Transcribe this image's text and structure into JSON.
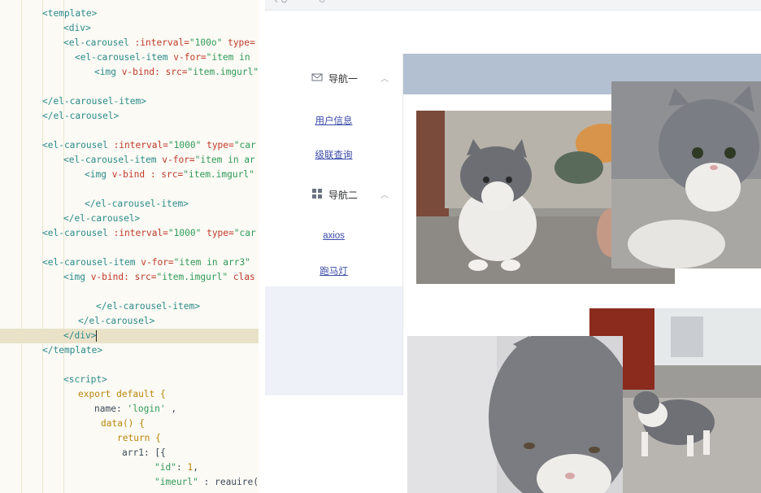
{
  "editor": {
    "lines": [
      [
        {
          "t": "<template>",
          "c": "tag"
        }
      ],
      [
        {
          "t": "<div>",
          "c": "tag"
        }
      ],
      [
        {
          "t": "<el-carousel ",
          "c": "tag"
        },
        {
          "t": ":interval=",
          "c": "attr"
        },
        {
          "t": "\"100o\"",
          "c": "str"
        },
        {
          "t": " type=",
          "c": "attr"
        }
      ],
      [
        {
          "t": "<el-carousel-item ",
          "c": "tag"
        },
        {
          "t": "v-for=",
          "c": "attr"
        },
        {
          "t": "\"item in",
          "c": "str"
        }
      ],
      [
        {
          "t": "<img ",
          "c": "tag"
        },
        {
          "t": "v-bind: src=",
          "c": "attr"
        },
        {
          "t": "\"item.imgurl\"",
          "c": "str"
        }
      ],
      [
        {
          "t": "",
          "c": "plain"
        }
      ],
      [
        {
          "t": "</el-carousel-item>",
          "c": "tag"
        }
      ],
      [
        {
          "t": "</el-carousel>",
          "c": "tag"
        }
      ],
      [
        {
          "t": "",
          "c": "plain"
        }
      ],
      [
        {
          "t": "<el-carousel ",
          "c": "tag"
        },
        {
          "t": ":interval=",
          "c": "attr"
        },
        {
          "t": "\"1000\"",
          "c": "str"
        },
        {
          "t": " type=",
          "c": "attr"
        },
        {
          "t": "\"car",
          "c": "str"
        }
      ],
      [
        {
          "t": "<el-carousel-item ",
          "c": "tag"
        },
        {
          "t": "v-for=",
          "c": "attr"
        },
        {
          "t": "\"item in ar",
          "c": "str"
        }
      ],
      [
        {
          "t": "<img ",
          "c": "tag"
        },
        {
          "t": "v-bind : src=",
          "c": "attr"
        },
        {
          "t": "\"item.imgurl\"",
          "c": "str"
        }
      ],
      [
        {
          "t": "",
          "c": "plain"
        }
      ],
      [
        {
          "t": "</el-carousel-item>",
          "c": "tag"
        }
      ],
      [
        {
          "t": "</el-carousel>",
          "c": "tag"
        }
      ],
      [
        {
          "t": "<el-carousel ",
          "c": "tag"
        },
        {
          "t": ":interval=",
          "c": "attr"
        },
        {
          "t": "\"1000\"",
          "c": "str"
        },
        {
          "t": " type=",
          "c": "attr"
        },
        {
          "t": "\"car",
          "c": "str"
        }
      ],
      [
        {
          "t": "",
          "c": "plain"
        }
      ],
      [
        {
          "t": "<el-carousel-item ",
          "c": "tag"
        },
        {
          "t": "v-for=",
          "c": "attr"
        },
        {
          "t": "\"item in arr3\"",
          "c": "str"
        }
      ],
      [
        {
          "t": "<img ",
          "c": "tag"
        },
        {
          "t": "v-bind: src=",
          "c": "attr"
        },
        {
          "t": "\"item.imgurl\"",
          "c": "str"
        },
        {
          "t": " clas",
          "c": "attr"
        }
      ],
      [
        {
          "t": "",
          "c": "plain"
        }
      ],
      [
        {
          "t": "</el-carousel-item>",
          "c": "tag"
        }
      ],
      [
        {
          "t": "</el-carousel>",
          "c": "tag"
        }
      ],
      [
        {
          "t": "</div>",
          "c": "tag"
        }
      ],
      [
        {
          "t": "</template>",
          "c": "tag"
        }
      ],
      [
        {
          "t": "",
          "c": "plain"
        }
      ],
      [
        {
          "t": "<script>",
          "c": "tag"
        }
      ],
      [
        {
          "t": "export default {",
          "c": "kw"
        }
      ],
      [
        {
          "t": "name: ",
          "c": "plain"
        },
        {
          "t": "'login'",
          "c": "str"
        },
        {
          "t": " ,",
          "c": "plain"
        }
      ],
      [
        {
          "t": "data() {",
          "c": "kw"
        }
      ],
      [
        {
          "t": "return {",
          "c": "kw"
        }
      ],
      [
        {
          "t": "arr1: [{",
          "c": "plain"
        }
      ],
      [
        {
          "t": "\"id\"",
          "c": "str"
        },
        {
          "t": ": ",
          "c": "plain"
        },
        {
          "t": "1",
          "c": "num"
        },
        {
          "t": ",",
          "c": "plain"
        }
      ],
      [
        {
          "t": "\"imeurl\"",
          "c": "str"
        },
        {
          "t": " : reauire(",
          "c": "plain"
        }
      ]
    ]
  },
  "nav": {
    "group1": "导航一",
    "group2": "导航二",
    "items": [
      "用户信息",
      "级联查询",
      "axios",
      "跑马灯"
    ]
  },
  "colors": {
    "header_band": "#b3c0d1",
    "sidebar_bottom": "#eef1f8",
    "link": "#3b4ba8"
  },
  "icons": [
    "mail-icon",
    "grid-icon",
    "chevron-up-icon"
  ]
}
